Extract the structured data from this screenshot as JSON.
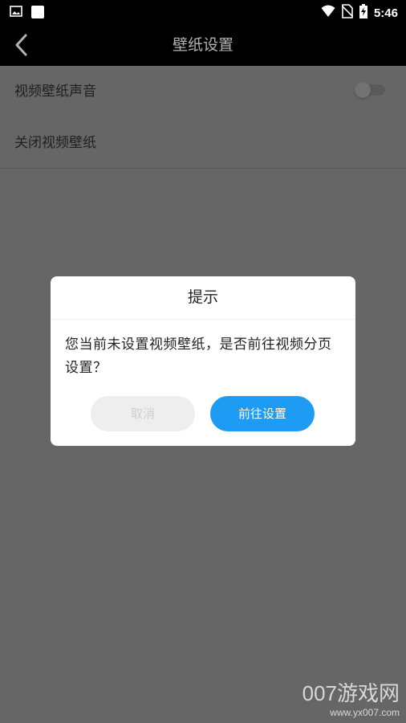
{
  "status_bar": {
    "time": "5:46",
    "icons": [
      "image-icon",
      "square-icon",
      "wifi-icon",
      "no-sim-icon",
      "battery-charging-icon"
    ]
  },
  "toolbar": {
    "title": "壁纸设置",
    "back_icon": "chevron-left-icon"
  },
  "settings": {
    "items": [
      {
        "label": "视频壁纸声音",
        "toggle": "off"
      },
      {
        "label": "关闭视频壁纸"
      }
    ]
  },
  "dialog": {
    "title": "提示",
    "message": "您当前未设置视频壁纸，是否前往视频分页设置？",
    "cancel_label": "取消",
    "confirm_label": "前往设置"
  },
  "watermark": {
    "brand": "007游戏网",
    "url": "www.yx007.com"
  },
  "colors": {
    "primary_button": "#1e9cf4",
    "overlay": "#666666",
    "toolbar": "#000000"
  }
}
